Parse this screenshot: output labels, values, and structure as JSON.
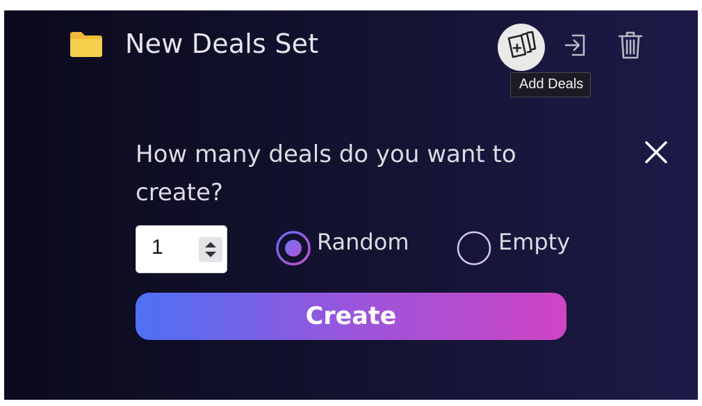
{
  "header": {
    "title": "New Deals Set",
    "folder_icon": "folder-icon",
    "folder_color": "#f5c842"
  },
  "toolbar": {
    "add_deals_icon": "add-cards-icon",
    "export_icon": "login-arrow-icon",
    "delete_icon": "trash-icon",
    "tooltip": "Add Deals"
  },
  "dialog": {
    "question": "How many deals do you want to create?",
    "quantity_value": "1",
    "options": [
      {
        "label": "Random",
        "selected": true
      },
      {
        "label": "Empty",
        "selected": false
      }
    ],
    "create_label": "Create",
    "close_icon": "close-icon"
  },
  "colors": {
    "background_dark": "#0b0a1c",
    "background_light": "#1d1a48",
    "button_gradient_start": "#4d71f3",
    "button_gradient_end": "#cf45c4"
  }
}
